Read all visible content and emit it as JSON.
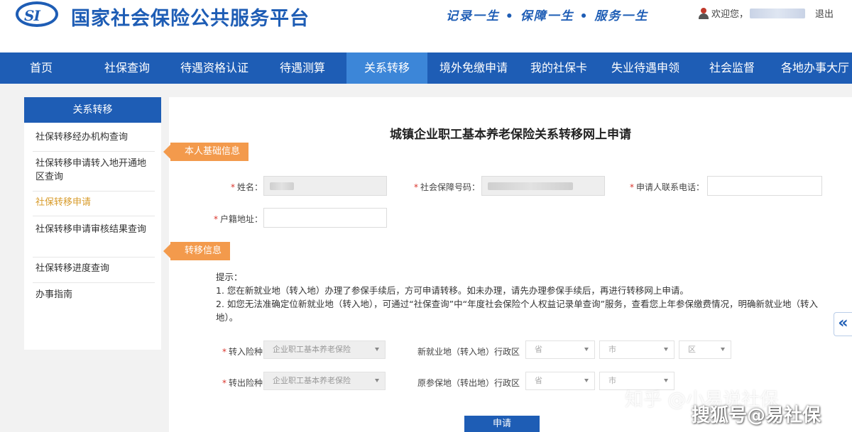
{
  "header": {
    "logo_text": "SI",
    "site_title": "国家社会保险公共服务平台",
    "slogan": "记录一生 • 保障一生 • 服务一生",
    "welcome": "欢迎您，",
    "logout": "退出"
  },
  "nav": {
    "items": [
      {
        "label": "首页"
      },
      {
        "label": "社保查询"
      },
      {
        "label": "待遇资格认证"
      },
      {
        "label": "待遇测算"
      },
      {
        "label": "关系转移",
        "active": true
      },
      {
        "label": "境外免缴申请"
      },
      {
        "label": "我的社保卡"
      },
      {
        "label": "失业待遇申领"
      },
      {
        "label": "社会监督"
      },
      {
        "label": "各地办事大厅"
      }
    ]
  },
  "sidebar": {
    "title": "关系转移",
    "items": [
      {
        "label": "社保转移经办机构查询"
      },
      {
        "label": "社保转移申请转入地开通地区查询"
      },
      {
        "label": "社保转移申请",
        "active": true
      },
      {
        "label": "社保转移申请审核结果查询"
      },
      {
        "label": "社保转移进度查询"
      },
      {
        "label": "办事指南"
      }
    ]
  },
  "form": {
    "title": "城镇企业职工基本养老保险关系转移网上申请",
    "section_personal": "本人基础信息",
    "section_transfer": "转移信息",
    "required_mark": "*",
    "labels": {
      "name": "姓名：",
      "ssn": "社会保障号码：",
      "phone": "申请人联系电话：",
      "hukou": "户籍地址："
    },
    "tips": {
      "heading": "提示：",
      "line1": "1. 您在新就业地（转入地）办理了参保手续后，方可申请转移。如未办理，请先办理参保手续后，再进行转移网上申请。",
      "line2": "2. 如您无法准确定位新就业地（转入地），可通过“社保查询”中“年度社会保险个人权益记录单查询”服务，查看您上年参保缴费情况，明确新就业地（转入地）。"
    },
    "transfer_in": {
      "label": "转入险种",
      "value": "企业职工基本养老保险",
      "region_label": "新就业地（转入地）行政区",
      "placeholders": [
        "省",
        "市",
        "区"
      ]
    },
    "transfer_out": {
      "label": "转出险种",
      "value": "企业职工基本养老保险",
      "region_label": "原参保地（转出地）行政区",
      "placeholders": [
        "省",
        "市"
      ]
    },
    "submit": "申请"
  },
  "watermarks": {
    "zhihu": "知乎 @小易说社保",
    "sohu": "搜狐号@易社保"
  }
}
